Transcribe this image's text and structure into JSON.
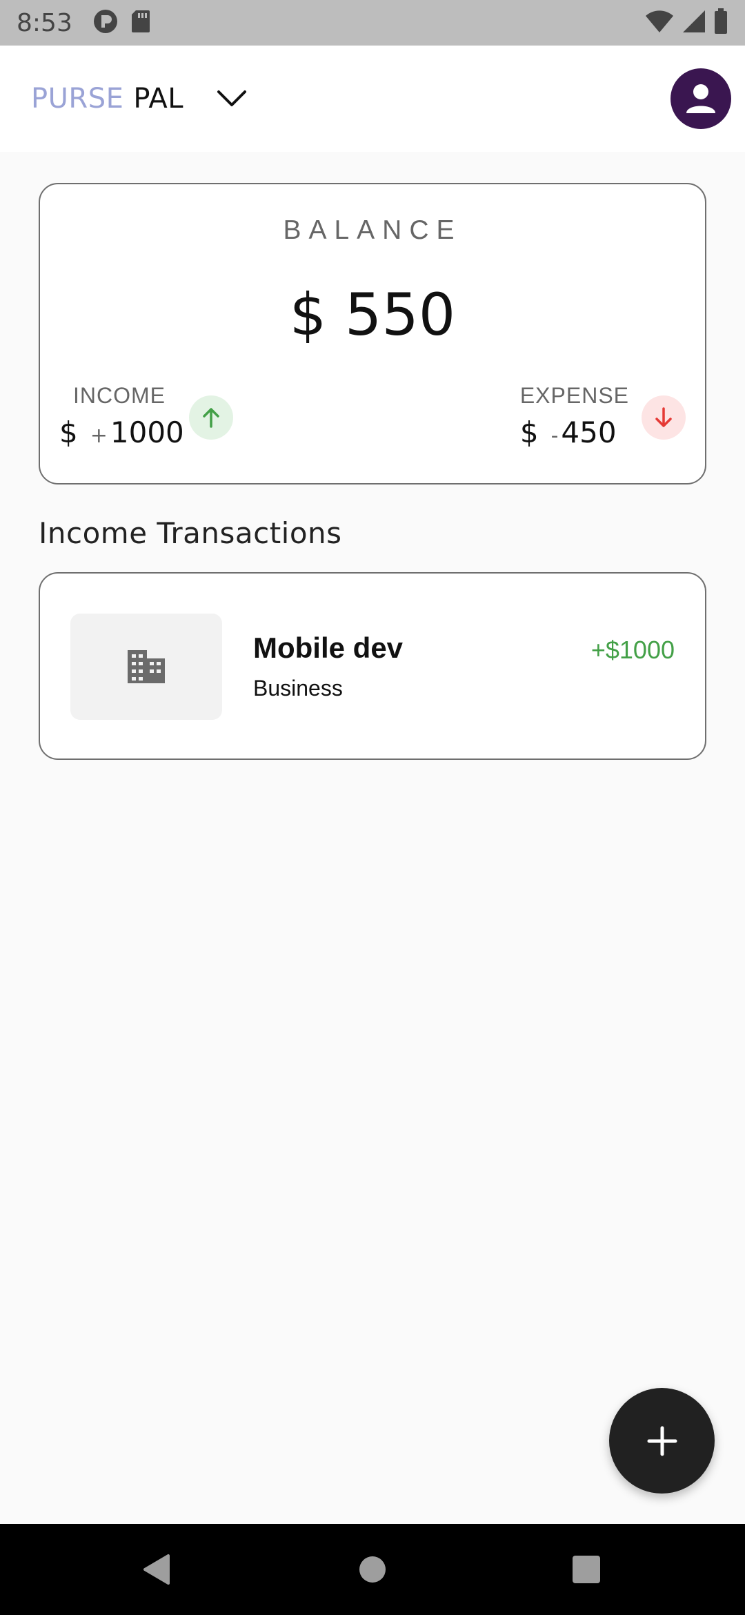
{
  "status_bar": {
    "time": "8:53"
  },
  "app_bar": {
    "brand_part1": "PURSE",
    "brand_part2": "PAL",
    "brand_part1_color": "#9aa3d6",
    "avatar_color": "#3a1650"
  },
  "balance": {
    "label": "BALANCE",
    "amount": "$ 550",
    "income": {
      "label": "INCOME",
      "currency": "$",
      "sign": "+",
      "value": "1000",
      "icon": "arrow-up-icon",
      "color": "#43a047"
    },
    "expense": {
      "label": "EXPENSE",
      "currency": "$",
      "sign": "-",
      "value": "450",
      "icon": "arrow-down-icon",
      "color": "#e53935"
    }
  },
  "transactions": {
    "title": "Income Transactions",
    "items": [
      {
        "title": "Mobile dev",
        "category": "Business",
        "amount": "+$1000",
        "icon": "business-building-icon"
      }
    ]
  },
  "fab": {
    "icon": "plus-icon"
  }
}
